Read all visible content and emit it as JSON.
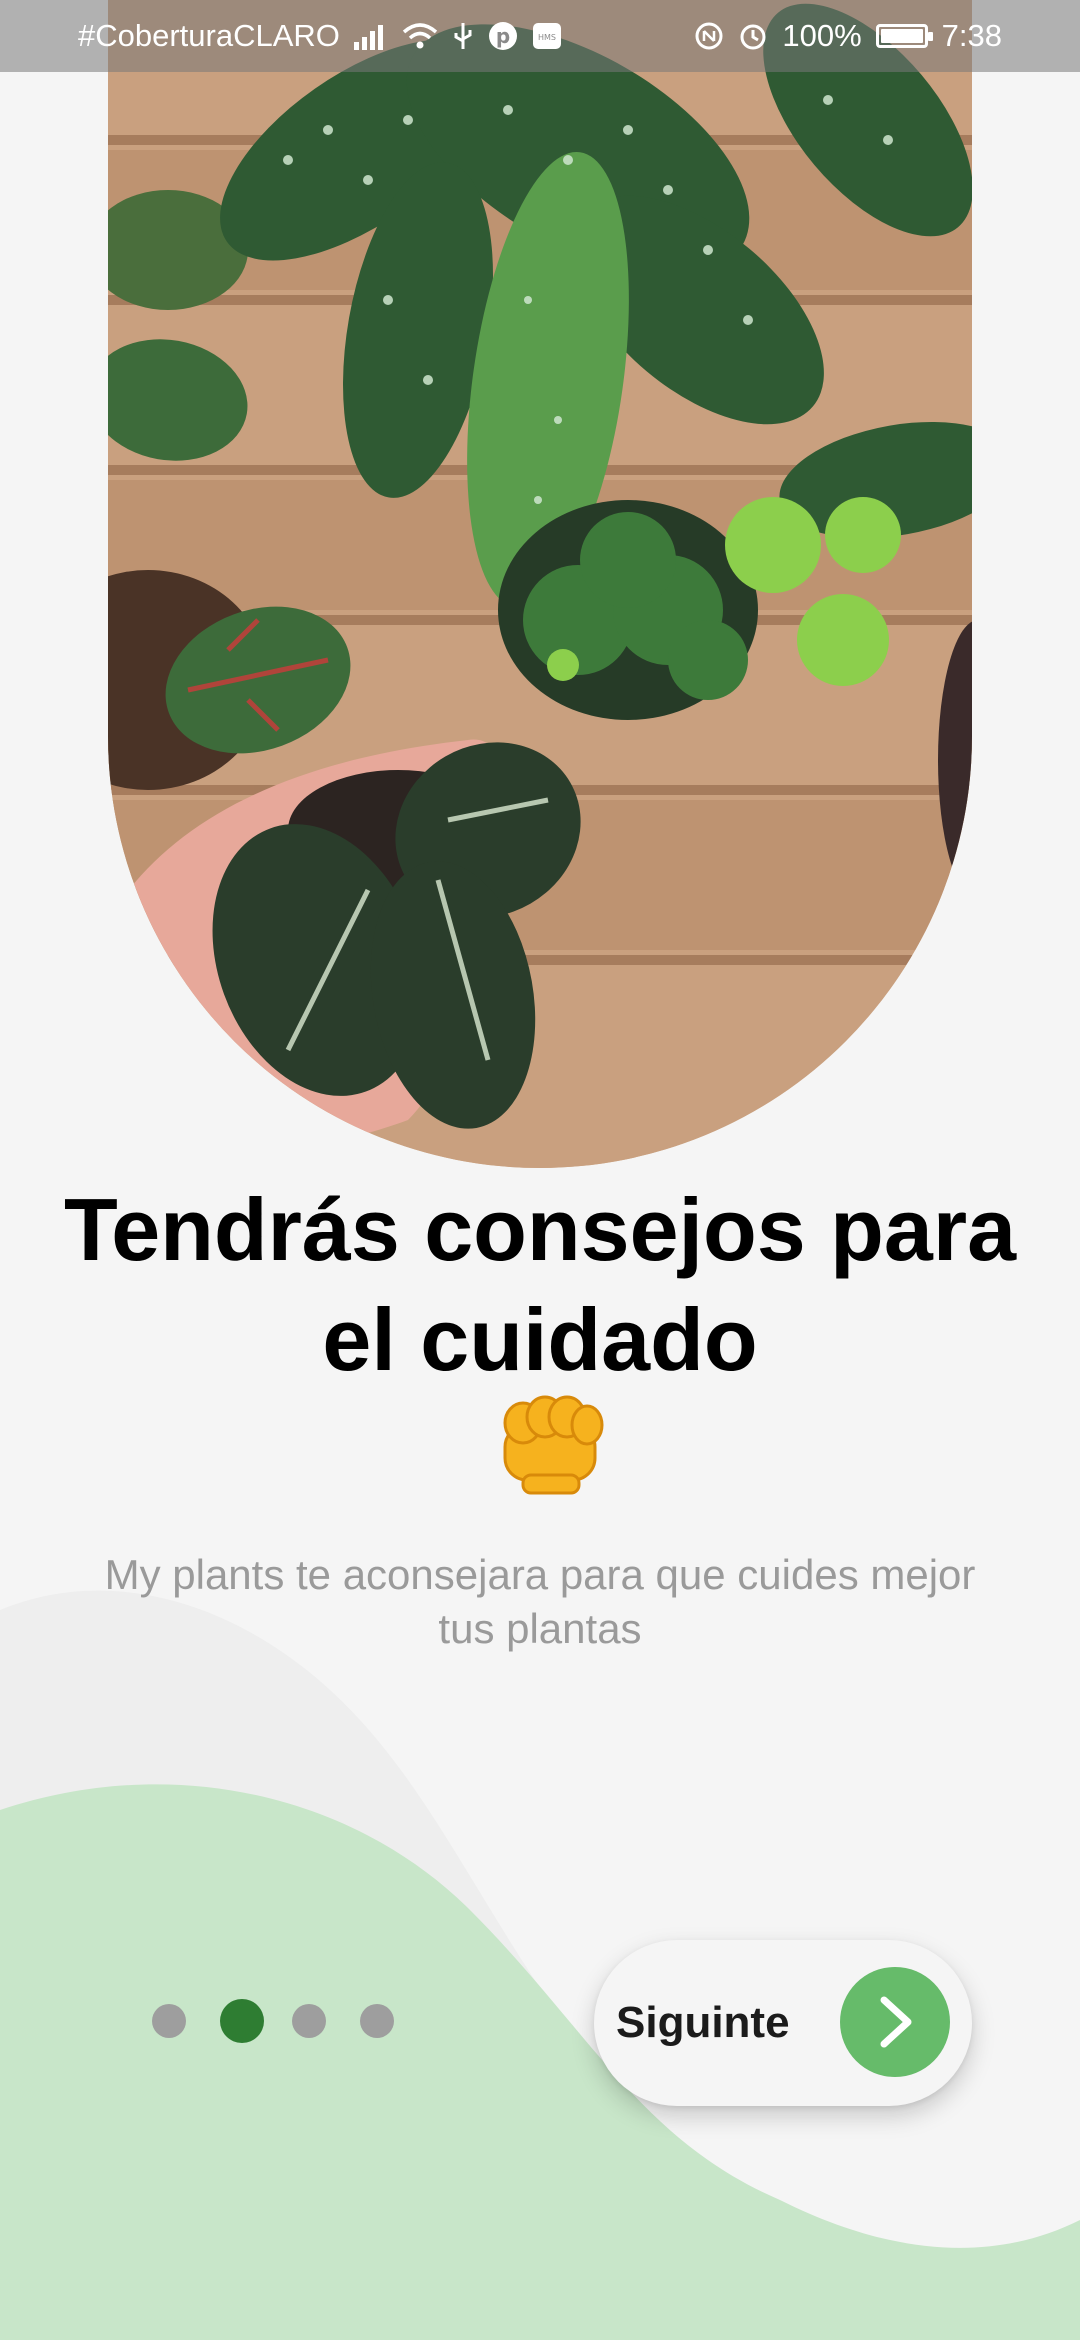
{
  "status_bar": {
    "carrier": "#CoberturaCLARO",
    "battery": "100%",
    "time": "7:38",
    "battery_level": 1.0,
    "icons": [
      "signal-icon",
      "wifi-icon",
      "usb-icon",
      "pinterest-icon",
      "hms-icon",
      "nfc-icon",
      "alarm-icon",
      "battery-icon"
    ]
  },
  "onboarding": {
    "title": "Tendrás consejos para el cuidado",
    "emoji": "oncoming-fist-icon",
    "subtitle": "My plants te aconsejara para que cuides mejor tus plantas",
    "page_indicator": {
      "total": 4,
      "current": 2
    },
    "next_label": "Siguinte",
    "next_icon": "chevron-right-icon"
  },
  "colors": {
    "background": "#f5f5f5",
    "wave_light": "#eeeeee",
    "wave_green": "#c8e6c9",
    "accent_green": "#66bb6a",
    "active_dot": "#2e7d32",
    "inactive_dot": "#9e9e9e"
  }
}
